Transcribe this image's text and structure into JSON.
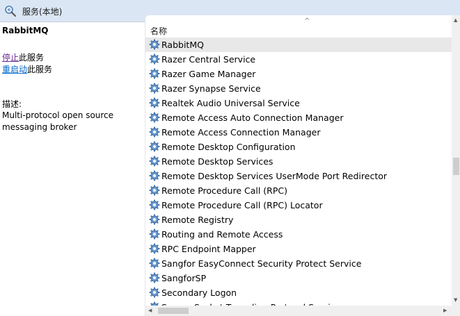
{
  "window": {
    "title": "服务(本地)",
    "title_icon": "services-magnifier-icon"
  },
  "left_pane": {
    "service_name": "RabbitMQ",
    "stop_link": "停止",
    "stop_suffix": "此服务",
    "restart_link": "重启动",
    "restart_suffix": "此服务",
    "description_label": "描述:",
    "description": "Multi-protocol open source messaging broker"
  },
  "list": {
    "column_header": "名称",
    "sort_indicator": "^",
    "row_icon": "gear-icon",
    "selected_index": 0,
    "rows": [
      "RabbitMQ",
      "Razer Central Service",
      "Razer Game Manager",
      "Razer Synapse Service",
      "Realtek Audio Universal Service",
      "Remote Access Auto Connection Manager",
      "Remote Access Connection Manager",
      "Remote Desktop Configuration",
      "Remote Desktop Services",
      "Remote Desktop Services UserMode Port Redirector",
      "Remote Procedure Call (RPC)",
      "Remote Procedure Call (RPC) Locator",
      "Remote Registry",
      "Routing and Remote Access",
      "RPC Endpoint Mapper",
      "Sangfor EasyConnect Security Protect Service",
      "SangforSP",
      "Secondary Logon",
      "Secure Socket Tunneling Protocol Service"
    ]
  },
  "colors": {
    "titlebar_bg": "#dbe6f4",
    "selected_row": "#e8e8e8",
    "link_stop": "#6b2b91",
    "link_restart": "#0066cc",
    "gear_blue": "#4a7fb8"
  }
}
